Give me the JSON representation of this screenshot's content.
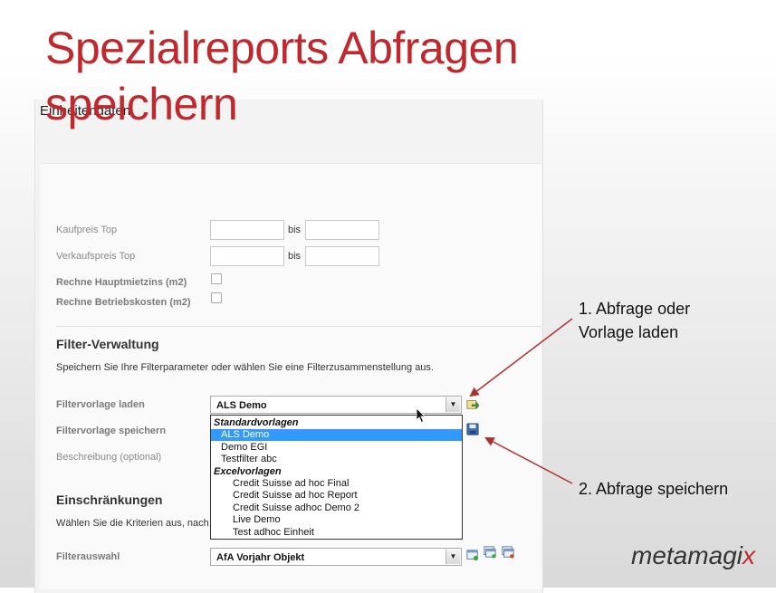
{
  "slide": {
    "title": "Spezialreports Abfragen speichern"
  },
  "panel": {
    "header": "Einheitendaten"
  },
  "fields": {
    "kaufpreis_label": "Kaufpreis Top",
    "kaufpreis_bis": "bis",
    "verkaufspreis_label": "Verkaufspreis Top",
    "verkaufspreis_bis": "bis",
    "hauptmietzins_label": "Rechne Hauptmietzins (m2)",
    "betriebskosten_label": "Rechne Betriebskosten (m2)"
  },
  "filter_verwaltung": {
    "heading": "Filter-Verwaltung",
    "description": "Speichern Sie Ihre Filterparameter oder wählen Sie eine Filterzusammenstellung aus.",
    "laden_label": "Filtervorlage laden",
    "laden_value": "ALS Demo",
    "speichern_label": "Filtervorlage speichern",
    "beschreibung_label": "Beschreibung (optional)"
  },
  "dropdown": {
    "items": [
      {
        "text": "Standardvorlagen",
        "kind": "group"
      },
      {
        "text": "ALS Demo",
        "kind": "opt",
        "selected": true
      },
      {
        "text": "Demo EGI",
        "kind": "opt"
      },
      {
        "text": "Testfilter abc",
        "kind": "opt"
      },
      {
        "text": "Excelvorlagen",
        "kind": "group"
      },
      {
        "text": "Credit Suisse ad hoc Final",
        "kind": "sub"
      },
      {
        "text": "Credit Suisse ad hoc Report",
        "kind": "sub"
      },
      {
        "text": "Credit Suisse adhoc Demo 2",
        "kind": "sub"
      },
      {
        "text": "Live Demo",
        "kind": "opt2"
      },
      {
        "text": "Test adhoc Einheit",
        "kind": "opt2"
      }
    ]
  },
  "einschraenkungen": {
    "heading": "Einschränkungen",
    "description": "Wählen Sie die Kriterien aus, nach",
    "filterauswahl_label": "Filterauswahl",
    "filterauswahl_value": "AfA Vorjahr Objekt"
  },
  "annotations": {
    "first_line1": "1. Abfrage oder",
    "first_line2": "Vorlage laden",
    "second": "2. Abfrage speichern"
  },
  "logo": {
    "main": "metamagi",
    "accent": "x"
  },
  "colors": {
    "title_red": "#c0282d",
    "selection_blue": "#3399ff",
    "arrow_red": "#b03030"
  }
}
